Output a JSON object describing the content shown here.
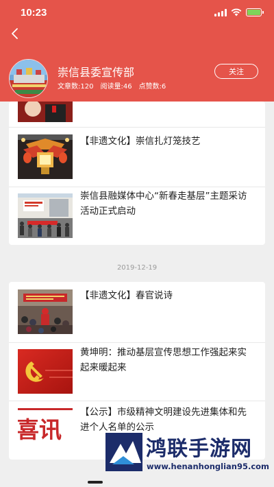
{
  "status_bar": {
    "time": "10:23",
    "battery_color": "#7ed35a"
  },
  "header": {
    "background": "#e5544a",
    "account_name": "崇信县委宣传部",
    "stats": {
      "articles": "文章数:120",
      "reads": "阅读量:46",
      "likes": "点赞数:6"
    },
    "follow_label": "关注",
    "back_icon": "chevron-left-icon"
  },
  "group1": {
    "articles": [
      {
        "title": "【非遗文化】崇信扎灯笼技艺"
      },
      {
        "title": "崇信县融媒体中心“新春走基层”主题采访活动正式启动"
      }
    ]
  },
  "date_separator": "2019-12-19",
  "group2": {
    "articles": [
      {
        "title": "【非遗文化】春官说诗"
      },
      {
        "title": "黄坤明：推动基层宣传思想工作强起来实起来暖起来"
      },
      {
        "title": "【公示】市级精神文明建设先进集体和先进个人名单的公示",
        "thumb_text": "喜讯"
      }
    ]
  },
  "watermark": {
    "text": "鸿联手游网",
    "url": "www.henanhonglian95.com"
  }
}
